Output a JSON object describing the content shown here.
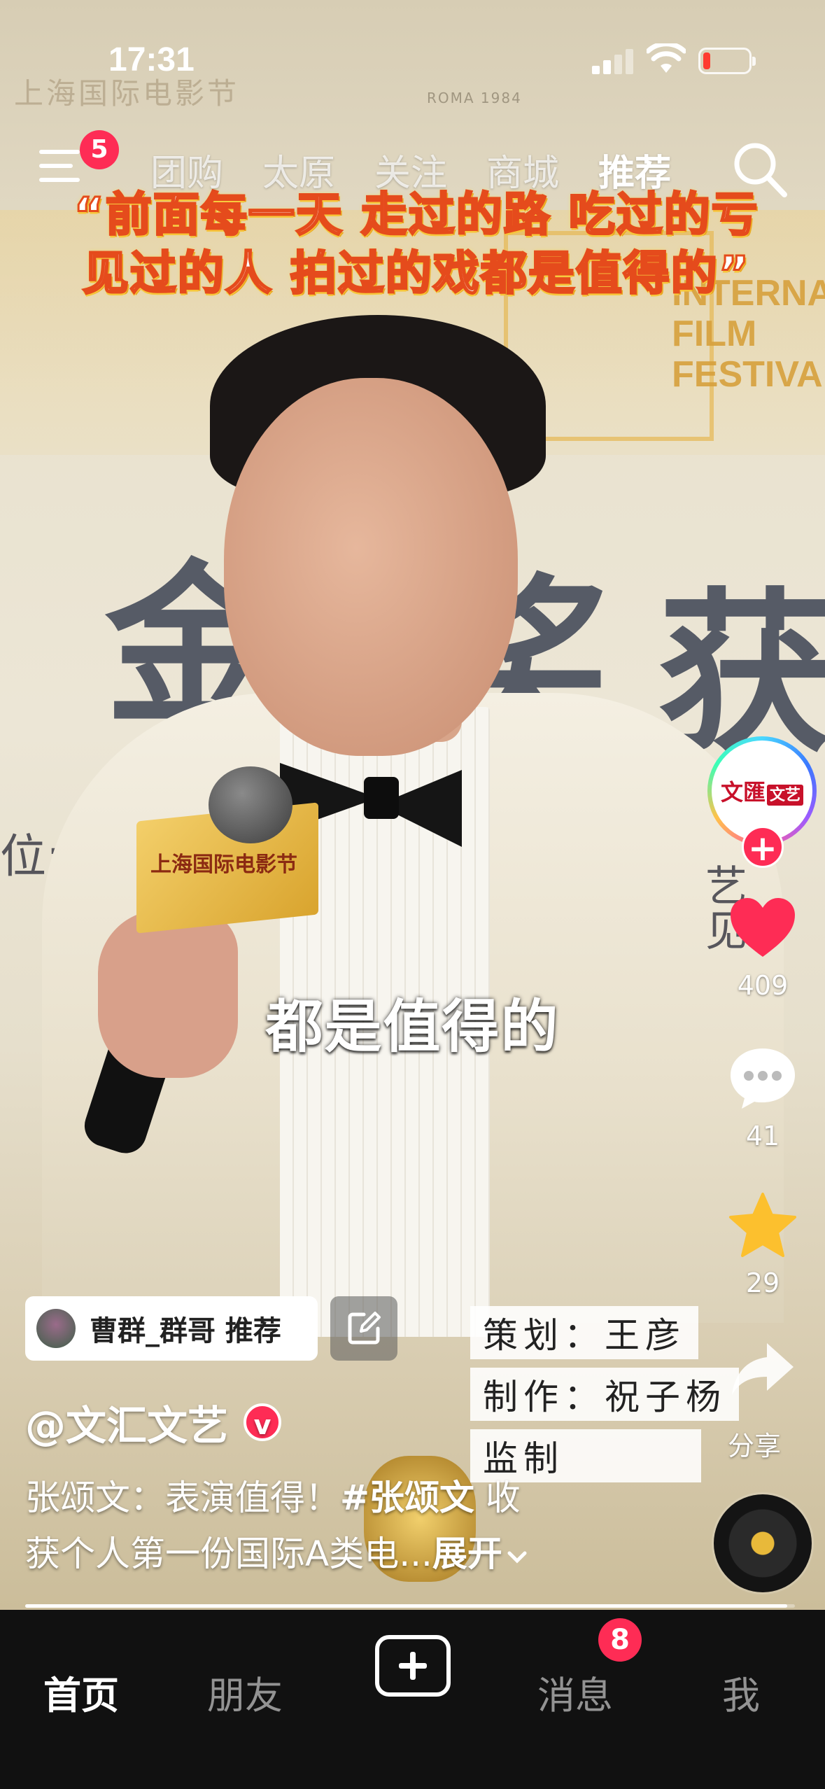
{
  "status_bar": {
    "time": "17:31",
    "battery_level": 0.1
  },
  "top_nav": {
    "menu_badge": "5",
    "tabs": [
      {
        "label": "团购",
        "active": false
      },
      {
        "label": "太原",
        "active": false
      },
      {
        "label": "关注",
        "active": false
      },
      {
        "label": "商城",
        "active": false
      },
      {
        "label": "推荐",
        "active": true
      }
    ]
  },
  "video": {
    "caption_lines": [
      "“前面每一天 走过的路 吃过的亏",
      "见过的人 拍过的戏都是值得的”"
    ],
    "subtitle": "都是值得的",
    "background_text": {
      "big_1": "金",
      "big_2": "奖",
      "big_3": "获",
      "small": "位:中央",
      "festival": [
        "INTERNATI",
        "FILM",
        "FESTIVAL"
      ],
      "roma": "ROMA 1984",
      "watermark": "上海国际电影节",
      "side": [
        "艺",
        "见"
      ]
    },
    "mic_flag": "上海国际电影节"
  },
  "sidebar": {
    "avatar_text": "文匯",
    "avatar_badge": "文艺",
    "follow_label": "+",
    "like_count": "409",
    "comment_count": "41",
    "favorite_count": "29",
    "share_label": "分享"
  },
  "info": {
    "recommend_text": "曹群_群哥 推荐",
    "credits": [
      "策划：王彦",
      "制作：祝子杨",
      "监制"
    ],
    "author": "@文汇文艺",
    "verified": "v",
    "description_1": "张颂文：表演值得！",
    "hashtag": "#张颂文",
    "description_2": " 收",
    "description_3": "获个人第一份国际A类电...",
    "expand_label": "展开",
    "progress": 0.99
  },
  "tab_bar": {
    "tabs": [
      "首页",
      "朋友",
      "消息",
      "我"
    ],
    "active": "首页",
    "message_badge": "8"
  },
  "colors": {
    "accent": "#fe2c55",
    "tabbar_bg": "#111111"
  }
}
